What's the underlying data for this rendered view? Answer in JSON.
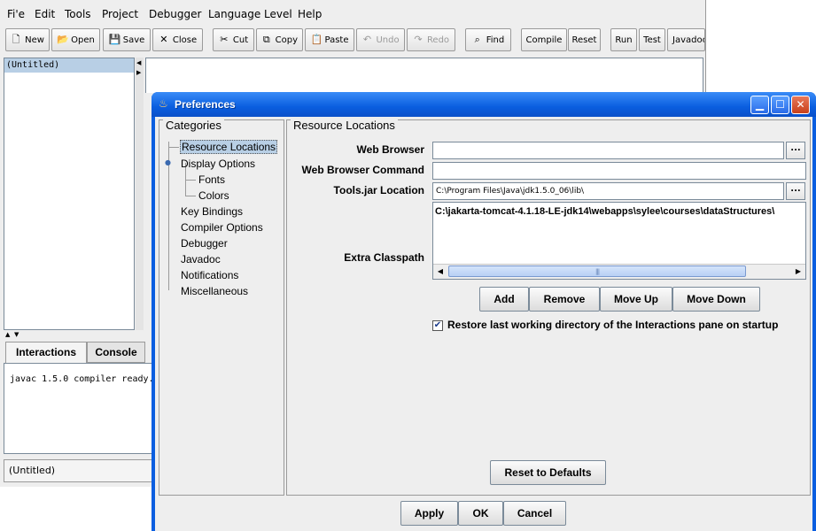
{
  "menubar": {
    "items": [
      "Fi'e",
      "Edit",
      "Tools",
      "Project",
      "Debugger",
      "Language Level",
      "Help"
    ]
  },
  "toolbar": {
    "new": "New",
    "open": "Open",
    "save": "Save",
    "close": "Close",
    "cut": "Cut",
    "copy": "Copy",
    "paste": "Paste",
    "undo": "Undo",
    "redo": "Redo",
    "find": "Find",
    "compile": "Compile",
    "reset": "Reset",
    "run": "Run",
    "test": "Test",
    "javadoc": "Javadoc"
  },
  "documents": {
    "items": [
      "(Untitled)"
    ]
  },
  "tabs": {
    "interactions": "Interactions",
    "console": "Console"
  },
  "interactions": {
    "text": "javac 1.5.0 compiler ready."
  },
  "status": {
    "file": "(Untitled)"
  },
  "dialog": {
    "title": "Preferences",
    "categories_title": "Categories",
    "categories": [
      "Resource Locations",
      "Display Options",
      "Fonts",
      "Colors",
      "Key Bindings",
      "Compiler Options",
      "Debugger",
      "Javadoc",
      "Notifications",
      "Miscellaneous"
    ],
    "panel_title": "Resource Locations",
    "labels": {
      "web_browser": "Web Browser",
      "web_browser_command": "Web Browser Command",
      "tools_jar": "Tools.jar Location",
      "extra_classpath": "Extra Classpath"
    },
    "values": {
      "web_browser": "",
      "web_browser_command": "",
      "tools_jar": "C:\\Program Files\\Java\\jdk1.5.0_06\\lib\\",
      "classpath_entry": "C:\\jakarta-tomcat-4.1.18-LE-jdk14\\webapps\\sylee\\courses\\dataStructures\\"
    },
    "browse_label": "...",
    "list_buttons": {
      "add": "Add",
      "remove": "Remove",
      "move_up": "Move Up",
      "move_down": "Move Down"
    },
    "restore_checkbox": {
      "label": "Restore last working directory of the Interactions pane on startup",
      "checked": true,
      "mark": "✔"
    },
    "reset_defaults": "Reset to Defaults",
    "footer": {
      "apply": "Apply",
      "ok": "OK",
      "cancel": "Cancel"
    }
  },
  "colors": {
    "titlebar": "#0a5ee0",
    "selection": "#b8cfe5"
  }
}
